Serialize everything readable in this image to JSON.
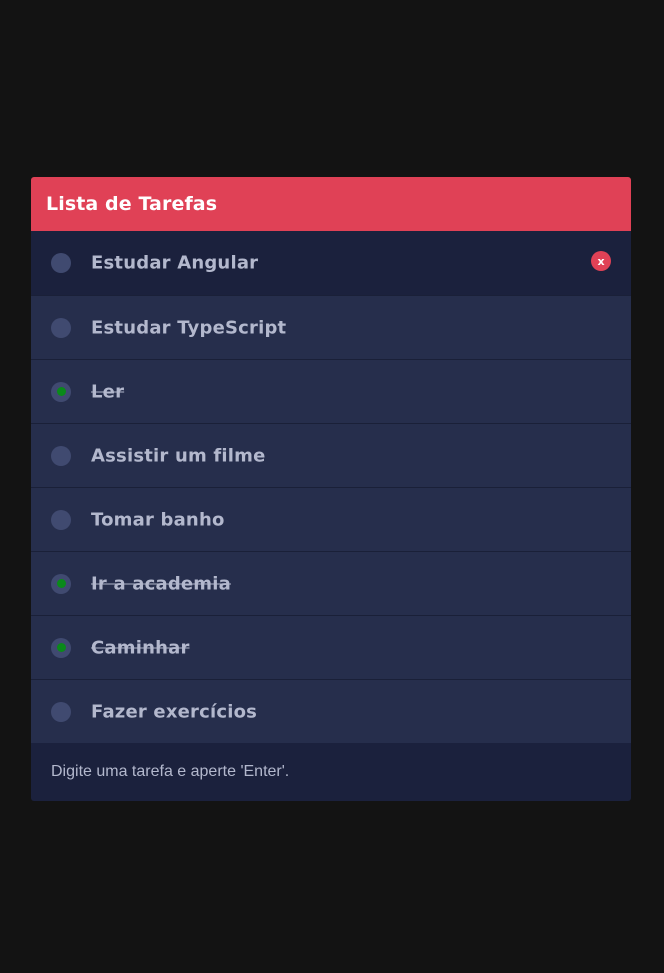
{
  "header": {
    "title": "Lista de Tarefas"
  },
  "tasks": [
    {
      "label": "Estudar Angular",
      "done": false,
      "hovered": true
    },
    {
      "label": "Estudar TypeScript",
      "done": false
    },
    {
      "label": "Ler",
      "done": true
    },
    {
      "label": "Assistir um filme",
      "done": false
    },
    {
      "label": "Tomar banho",
      "done": false
    },
    {
      "label": "Ir a academia",
      "done": true
    },
    {
      "label": "Caminhar",
      "done": true
    },
    {
      "label": "Fazer exercícios",
      "done": false
    }
  ],
  "delete_label": "x",
  "input": {
    "placeholder": "Digite uma tarefa e aperte 'Enter'.",
    "value": ""
  },
  "colors": {
    "background": "#131313",
    "header": "#e04156",
    "row": "#262e4c",
    "row_hover": "#1b213d",
    "footer": "#1b213d",
    "text": "#b3b8cd",
    "radio": "#404a70",
    "check": "#0a8a1a",
    "delete": "#e04156"
  }
}
